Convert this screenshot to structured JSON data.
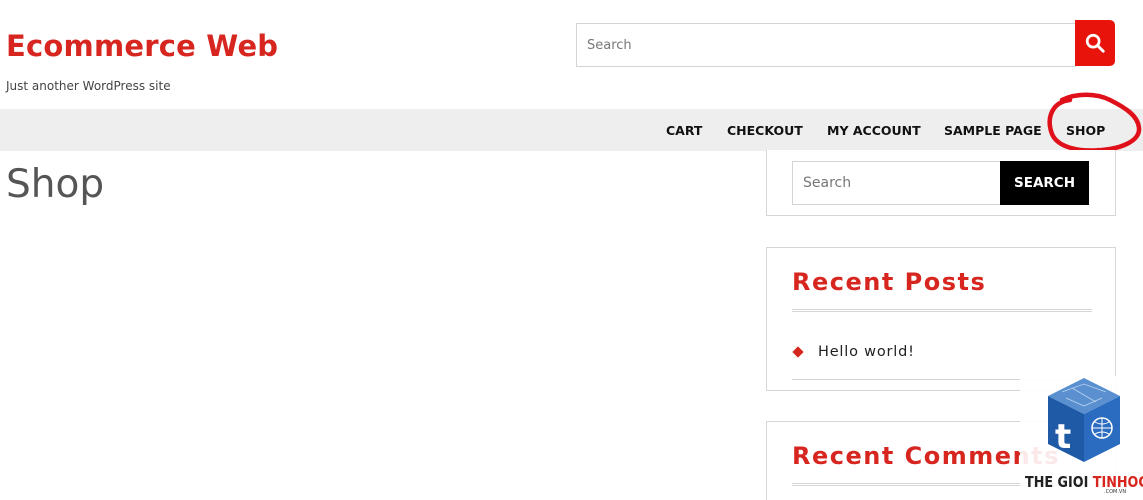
{
  "site": {
    "title": "Ecommerce Web",
    "tagline": "Just another WordPress site"
  },
  "header_search": {
    "placeholder": "Search",
    "button_icon": "search-icon"
  },
  "nav": {
    "items": [
      {
        "label": "CART"
      },
      {
        "label": "CHECKOUT"
      },
      {
        "label": "MY ACCOUNT"
      },
      {
        "label": "SAMPLE PAGE"
      },
      {
        "label": "SHOP",
        "annotated": true
      }
    ]
  },
  "main": {
    "page_title": "Shop"
  },
  "sidebar": {
    "search": {
      "placeholder": "Search",
      "button_label": "SEARCH"
    },
    "recent_posts": {
      "title": "Recent Posts",
      "items": [
        {
          "label": "Hello world!"
        }
      ]
    },
    "recent_comments": {
      "title": "Recent Comments"
    }
  },
  "watermark": {
    "brand_part1": "THE GIOI ",
    "brand_part2": "TINHOC",
    "domain": ".COM.VN",
    "letter": "t"
  },
  "colors": {
    "brand_red": "#d7261f",
    "search_button_red": "#e8140c",
    "nav_background": "#eeeeee",
    "annotation_red": "#e0101a"
  }
}
